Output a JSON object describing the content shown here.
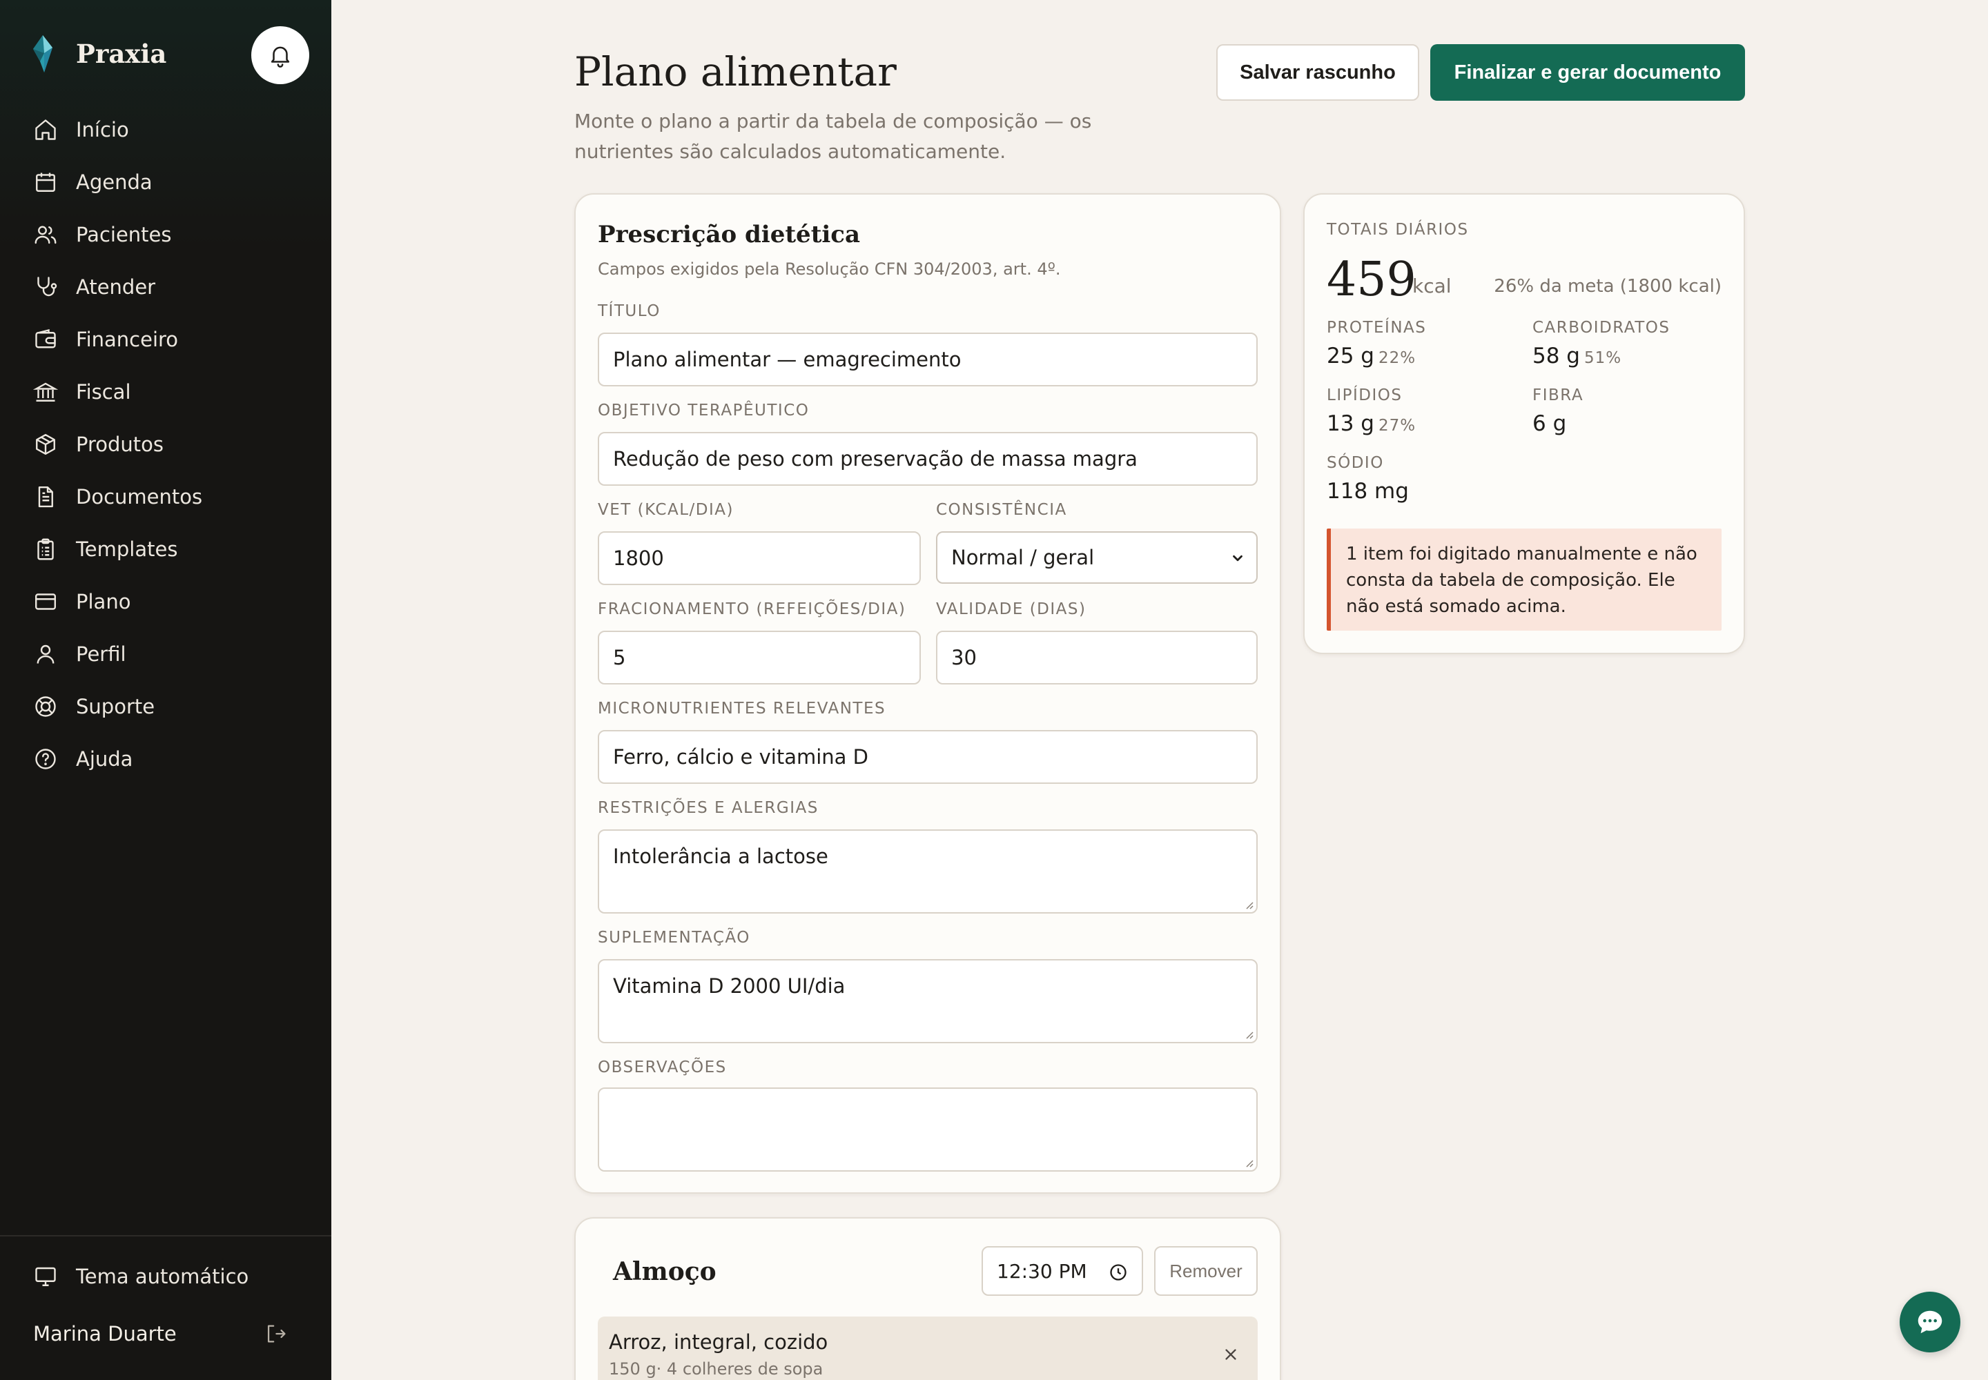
{
  "brand": {
    "name": "Praxia"
  },
  "sidebar": {
    "items": [
      {
        "label": "Início",
        "icon": "home-icon"
      },
      {
        "label": "Agenda",
        "icon": "calendar-icon"
      },
      {
        "label": "Pacientes",
        "icon": "users-icon"
      },
      {
        "label": "Atender",
        "icon": "stethoscope-icon"
      },
      {
        "label": "Financeiro",
        "icon": "wallet-icon"
      },
      {
        "label": "Fiscal",
        "icon": "bank-icon"
      },
      {
        "label": "Produtos",
        "icon": "box-icon"
      },
      {
        "label": "Documentos",
        "icon": "document-icon"
      },
      {
        "label": "Templates",
        "icon": "clipboard-icon"
      },
      {
        "label": "Plano",
        "icon": "credit-card-icon"
      },
      {
        "label": "Perfil",
        "icon": "user-icon"
      },
      {
        "label": "Suporte",
        "icon": "lifebuoy-icon"
      },
      {
        "label": "Ajuda",
        "icon": "help-circle-icon"
      }
    ],
    "theme_label": "Tema automático",
    "user_name": "Marina Duarte"
  },
  "header": {
    "title": "Plano alimentar",
    "subtitle": "Monte o plano a partir da tabela de composição — os nutrientes são calculados automaticamente.",
    "save_draft_label": "Salvar rascunho",
    "finalize_label": "Finalizar e gerar documento"
  },
  "prescription": {
    "title": "Prescrição dietética",
    "subtitle": "Campos exigidos pela Resolução CFN 304/2003, art. 4º.",
    "fields": {
      "title_label": "TÍTULO",
      "title_value": "Plano alimentar — emagrecimento",
      "objective_label": "OBJETIVO TERAPÊUTICO",
      "objective_value": "Redução de peso com preservação de massa magra",
      "vet_label": "VET (KCAL/DIA)",
      "vet_value": "1800",
      "consistency_label": "CONSISTÊNCIA",
      "consistency_value": "Normal / geral",
      "fraction_label": "FRACIONAMENTO (REFEIÇÕES/DIA)",
      "fraction_value": "5",
      "validity_label": "VALIDADE (DIAS)",
      "validity_value": "30",
      "micro_label": "MICRONUTRIENTES RELEVANTES",
      "micro_value": "Ferro, cálcio e vitamina D",
      "restrictions_label": "RESTRIÇÕES E ALERGIAS",
      "restrictions_value": "Intolerância a lactose",
      "supplement_label": "SUPLEMENTAÇÃO",
      "supplement_value": "Vitamina D 2000 UI/dia",
      "notes_label": "OBSERVAÇÕES",
      "notes_value": ""
    }
  },
  "totals": {
    "heading": "TOTAIS DIÁRIOS",
    "kcal": "459",
    "kcal_unit": "kcal",
    "goal_text": "26% da meta (1800 kcal)",
    "protein_label": "PROTEÍNAS",
    "protein_value": "25 g",
    "protein_pct": "22%",
    "carbs_label": "CARBOIDRATOS",
    "carbs_value": "58 g",
    "carbs_pct": "51%",
    "lipids_label": "LIPÍDIOS",
    "lipids_value": "13 g",
    "lipids_pct": "27%",
    "fiber_label": "FIBRA",
    "fiber_value": "6 g",
    "sodium_label": "SÓDIO",
    "sodium_value": "118 mg",
    "warning": "1 item foi digitado manualmente e não consta da tabela de composição. Ele não está somado acima."
  },
  "meal": {
    "title": "Almoço",
    "time": "12:30 PM",
    "remove_label": "Remover",
    "items": [
      {
        "name": "Arroz, integral, cozido",
        "qty": "150 g· 4 colheres de sopa"
      }
    ]
  },
  "colors": {
    "accent": "#146b54",
    "sidebar_bg": "#161513",
    "page_bg": "#f5f1ec",
    "warning_border": "#d4542e",
    "warning_bg": "#fae5dc"
  }
}
